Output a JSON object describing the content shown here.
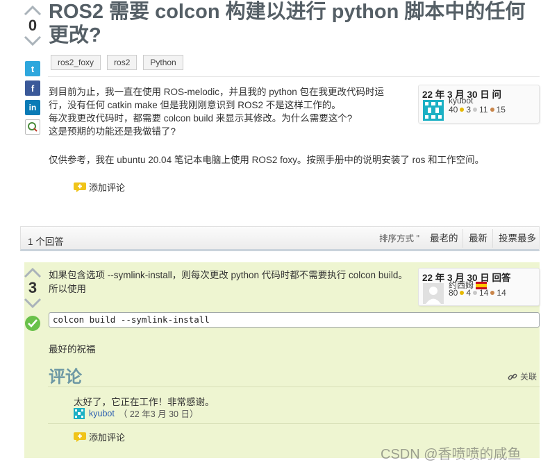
{
  "question": {
    "title": "ROS2 需要 colcon 构建以进行 python 脚本中的任何更改?",
    "votes": "0",
    "tags": [
      "ros2_foxy",
      "ros2",
      "Python"
    ],
    "body_lines": "到目前为止，我一直在使用 ROS-melodic，并且我的 python 包在我更改代码时运\n行，没有任何 catkin make 但是我刚刚意识到 ROS2 不是这样工作的。\n每次我更改代码时，都需要 colcon build 来显示其修改。为什么需要这个?\n这是预期的功能还是我做错了?",
    "body_extra": "仅供参考，我在 ubuntu 20.04 笔记本电脑上使用 ROS2 foxy。按照手册中的说明安装了 ros 和工作空间。",
    "add_comment": "添加评论",
    "asker": {
      "date_label": "22 年 3 月 30 日 问",
      "name": "kyubot",
      "karma": "40",
      "gold": "3",
      "silver": "11",
      "bronze": "15"
    }
  },
  "social": {
    "twitter": "t",
    "facebook": "f",
    "linkedin": "in"
  },
  "answers_bar": {
    "count": "1 个回答",
    "sort_label": "排序方式 \"",
    "tabs": [
      "最老的",
      "最新",
      "投票最多"
    ]
  },
  "answer": {
    "votes": "3",
    "text": "如果包含选项 --symlink-install，则每次更改 python 代码时都不需要执行 colcon build。所以使用",
    "code": "colcon build --symlink-install",
    "regards": "最好的祝福",
    "answerer": {
      "date_label": "22 年 3 月 30 日 回答",
      "name": "约西姆",
      "karma": "80",
      "gold": "4",
      "silver": "14",
      "bronze": "14"
    },
    "comments_heading": "评论",
    "follow_label": "关联",
    "comment": {
      "text": "太好了，它正在工作！非常感谢。",
      "user": "kyubot",
      "date": "（ 22 年3 月 30 日）"
    },
    "add_comment": "添加评论"
  },
  "watermark": "CSDN @香喷喷的咸鱼",
  "colors": {
    "title": "#555f66",
    "answer_bg": "#eef5d1",
    "comments_heading": "#6d98a4",
    "accepted": "#69c14a"
  }
}
